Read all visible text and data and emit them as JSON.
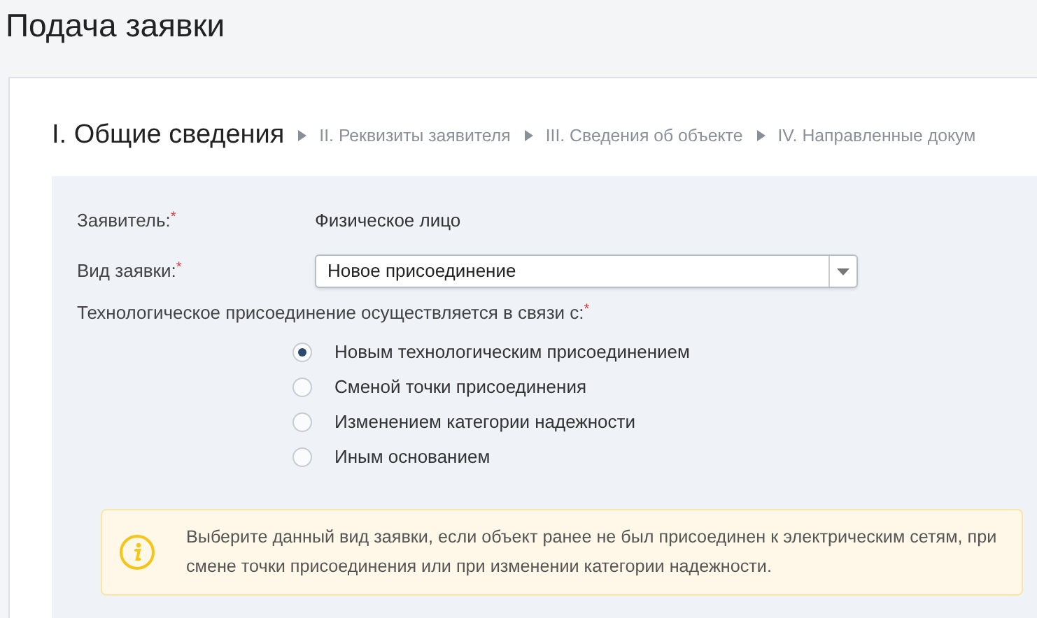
{
  "page_title": "Подача заявки",
  "steps": [
    {
      "label": "I. Общие сведения",
      "selected": true
    },
    {
      "label": "II. Реквизиты заявителя",
      "selected": false
    },
    {
      "label": "III. Сведения об объекте",
      "selected": false
    },
    {
      "label": "IV. Направленные докум",
      "selected": false
    }
  ],
  "fields": [
    {
      "kind": "static",
      "label": "Заявитель:",
      "required_mark": "*",
      "value": "Физическое лицо"
    },
    {
      "kind": "select",
      "label": "Вид заявки:",
      "required_mark": "*",
      "value": "Новое присоединение"
    }
  ],
  "reason": {
    "label": "Технологическое присоединение осуществляется в связи с:",
    "required_mark": "*",
    "options": [
      {
        "label": "Новым технологическим присоединением",
        "selected": true
      },
      {
        "label": "Сменой точки присоединения",
        "selected": false
      },
      {
        "label": "Изменением категории надежности",
        "selected": false
      },
      {
        "label": "Иным основанием",
        "selected": false
      }
    ]
  },
  "notice": {
    "text": "Выберите данный вид заявки, если объект ранее не был присоединен к электрическим сетям, при смене точки присоединения или при изменении категории надежности."
  }
}
